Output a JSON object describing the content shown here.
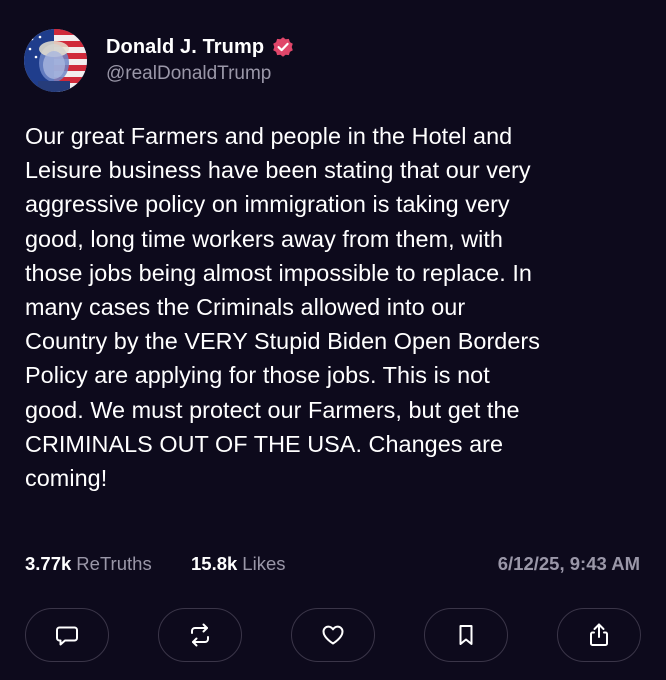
{
  "author": {
    "display_name": "Donald J. Trump",
    "handle": "@realDonaldTrump",
    "verified": true
  },
  "post": {
    "text": "Our great Farmers and people in the Hotel and\nLeisure business have been stating that our very\naggressive policy on immigration is taking very\ngood, long time workers away from them, with\nthose jobs being almost impossible to replace. In\nmany cases the Criminals allowed into our\nCountry by the VERY Stupid Biden Open Borders\nPolicy are applying for those jobs. This is not\ngood. We must protect our Farmers, but get the\nCRIMINALS OUT OF THE USA. Changes are\ncoming!"
  },
  "stats": {
    "retruths_count": "3.77k",
    "retruths_label": "ReTruths",
    "likes_count": "15.8k",
    "likes_label": "Likes",
    "timestamp": "6/12/25, 9:43 AM"
  },
  "actions": [
    {
      "icon": "comment-icon"
    },
    {
      "icon": "retruth-icon"
    },
    {
      "icon": "heart-icon"
    },
    {
      "icon": "bookmark-icon"
    },
    {
      "icon": "share-icon"
    }
  ],
  "colors": {
    "background": "#0d0a1c",
    "text": "#ffffff",
    "muted": "#9a97a8",
    "verified_badge": "#e0466a",
    "button_border": "#3a3548"
  }
}
